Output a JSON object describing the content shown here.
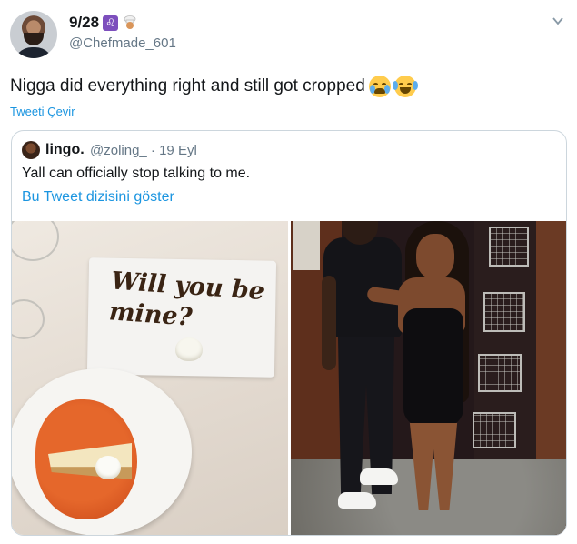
{
  "tweet": {
    "display_name": "9/28",
    "zodiac_badge": "♌",
    "handle": "@Chefmade_601",
    "text": "Nigga did everything right and still got cropped",
    "emojis": [
      "crying-face-emoji",
      "tears-of-joy-emoji"
    ],
    "translate_label": "Tweeti Çevir",
    "menu_icon": "chevron-down-icon"
  },
  "quote": {
    "name": "lingo.",
    "meta": "@zoling_ · 19 Eyl",
    "text": "Yall can officially stop talking to me.",
    "thread_link": "Bu Tweet dizisini göster",
    "images": [
      "dessert-plate-photo",
      "couple-photo"
    ],
    "dessert_message": "Will you be mine?"
  },
  "colors": {
    "link": "#1b95e0",
    "secondary_text": "#657786",
    "border": "#ccd6dd",
    "badge": "#7d4fbd"
  }
}
